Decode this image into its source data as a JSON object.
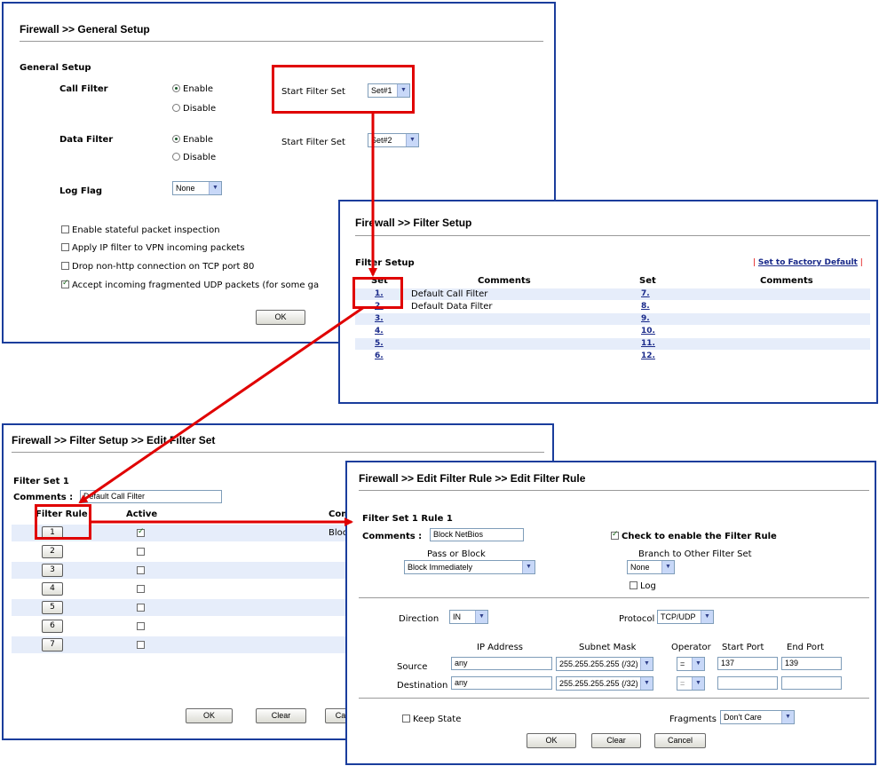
{
  "general": {
    "title": "Firewall >> General Setup",
    "section": "General Setup",
    "call_filter_label": "Call Filter",
    "data_filter_label": "Data Filter",
    "log_flag_label": "Log Flag",
    "enable_label": "Enable",
    "disable_label": "Disable",
    "start_filter_set_label": "Start Filter Set",
    "call_start_set": "Set#1",
    "data_start_set": "Set#2",
    "log_flag_value": "None",
    "options": [
      {
        "label": "Enable stateful packet inspection",
        "checked": false
      },
      {
        "label": "Apply IP filter to VPN incoming packets",
        "checked": false
      },
      {
        "label": "Drop non-http connection on TCP port 80",
        "checked": false
      },
      {
        "label": "Accept incoming fragmented UDP packets (for some ga",
        "checked": true
      }
    ],
    "ok_label": "OK"
  },
  "filter_setup": {
    "title": "Firewall >> Filter Setup",
    "section": "Filter Setup",
    "factory_default": "Set to Factory Default",
    "headers": {
      "set": "Set",
      "comments": "Comments",
      "set2": "Set",
      "comments2": "Comments"
    },
    "rows": [
      {
        "left_set": "1.",
        "left_comment": "Default Call Filter",
        "right_set": "7."
      },
      {
        "left_set": "2.",
        "left_comment": "Default Data Filter",
        "right_set": "8."
      },
      {
        "left_set": "3.",
        "left_comment": "",
        "right_set": "9."
      },
      {
        "left_set": "4.",
        "left_comment": "",
        "right_set": "10."
      },
      {
        "left_set": "5.",
        "left_comment": "",
        "right_set": "11."
      },
      {
        "left_set": "6.",
        "left_comment": "",
        "right_set": "12."
      }
    ]
  },
  "edit_set": {
    "title": "Firewall >> Filter Setup >> Edit Filter Set",
    "set_label": "Filter Set 1",
    "comments_label": "Comments :",
    "comments_value": "Default Call Filter",
    "col_rule": "Filter Rule",
    "col_active": "Active",
    "col_comments": "Com",
    "rules": [
      {
        "num": "1",
        "active": true,
        "comment": "Bloc"
      },
      {
        "num": "2",
        "active": false,
        "comment": ""
      },
      {
        "num": "3",
        "active": false,
        "comment": ""
      },
      {
        "num": "4",
        "active": false,
        "comment": ""
      },
      {
        "num": "5",
        "active": false,
        "comment": ""
      },
      {
        "num": "6",
        "active": false,
        "comment": ""
      },
      {
        "num": "7",
        "active": false,
        "comment": ""
      }
    ],
    "ok_label": "OK",
    "clear_label": "Clear",
    "cancel_label": "Can"
  },
  "edit_rule": {
    "title": "Firewall >> Edit Filter Rule >> Edit Filter Rule",
    "rule_label": "Filter Set 1 Rule 1",
    "comments_label": "Comments :",
    "comments_value": "Block NetBios",
    "enable_rule_label": "Check to enable the Filter Rule",
    "pass_block_label": "Pass or Block",
    "pass_block_value": "Block Immediately",
    "branch_label": "Branch to Other Filter Set",
    "branch_value": "None",
    "log_label": "Log",
    "direction_label": "Direction",
    "direction_value": "IN",
    "protocol_label": "Protocol",
    "protocol_value": "TCP/UDP",
    "col_ip": "IP Address",
    "col_mask": "Subnet Mask",
    "col_operator": "Operator",
    "col_start": "Start Port",
    "col_end": "End Port",
    "source_label": "Source",
    "source_ip": "any",
    "source_mask": "255.255.255.255 (/32)",
    "source_op": "=",
    "source_start": "137",
    "source_end": "139",
    "dest_label": "Destination",
    "dest_ip": "any",
    "dest_mask": "255.255.255.255 (/32)",
    "dest_op": "=",
    "dest_start": "",
    "dest_end": "",
    "keep_state_label": "Keep State",
    "fragments_label": "Fragments",
    "fragments_value": "Don't Care",
    "ok_label": "OK",
    "clear_label": "Clear",
    "cancel_label": "Cancel"
  },
  "colors": {
    "window_border": "#1a3d9c",
    "highlight": "#e00000",
    "row_alt": "#e6edfa"
  }
}
